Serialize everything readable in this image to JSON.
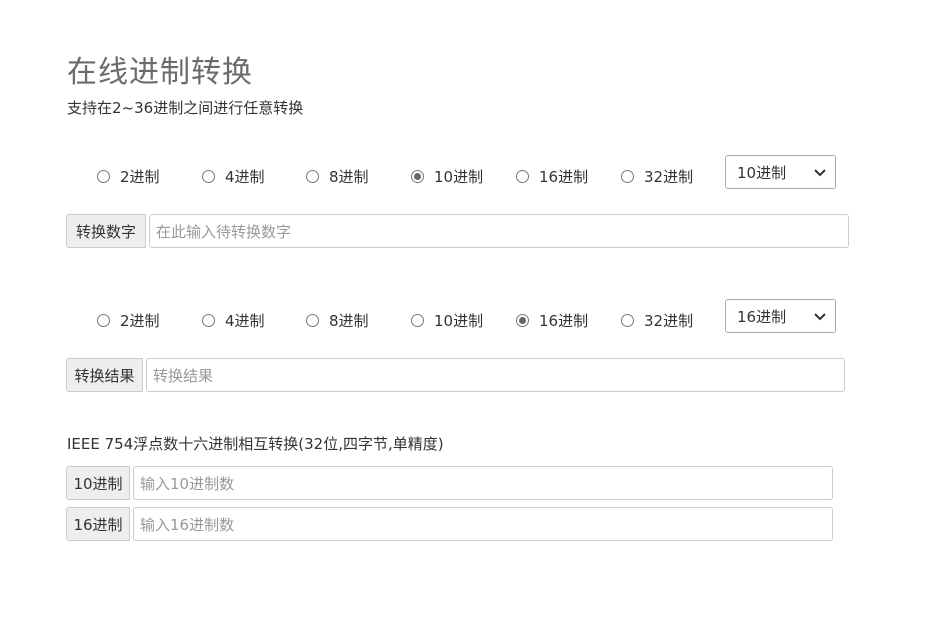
{
  "page": {
    "title": "在线进制转换",
    "subtitle": "支持在2~36进制之间进行任意转换"
  },
  "input_section": {
    "radios": [
      {
        "label": "2进制",
        "checked": false
      },
      {
        "label": "4进制",
        "checked": false
      },
      {
        "label": "8进制",
        "checked": false
      },
      {
        "label": "10进制",
        "checked": true
      },
      {
        "label": "16进制",
        "checked": false
      },
      {
        "label": "32进制",
        "checked": false
      }
    ],
    "select_value": "10进制",
    "addon_label": "转换数字",
    "placeholder": "在此输入待转换数字"
  },
  "output_section": {
    "radios": [
      {
        "label": "2进制",
        "checked": false
      },
      {
        "label": "4进制",
        "checked": false
      },
      {
        "label": "8进制",
        "checked": false
      },
      {
        "label": "10进制",
        "checked": false
      },
      {
        "label": "16进制",
        "checked": true
      },
      {
        "label": "32进制",
        "checked": false
      }
    ],
    "select_value": "16进制",
    "addon_label": "转换结果",
    "placeholder": "转换结果"
  },
  "ieee": {
    "title": "IEEE 754浮点数十六进制相互转换(32位,四字节,单精度)",
    "dec_label": "10进制",
    "dec_placeholder": "输入10进制数",
    "hex_label": "16进制",
    "hex_placeholder": "输入16进制数"
  }
}
